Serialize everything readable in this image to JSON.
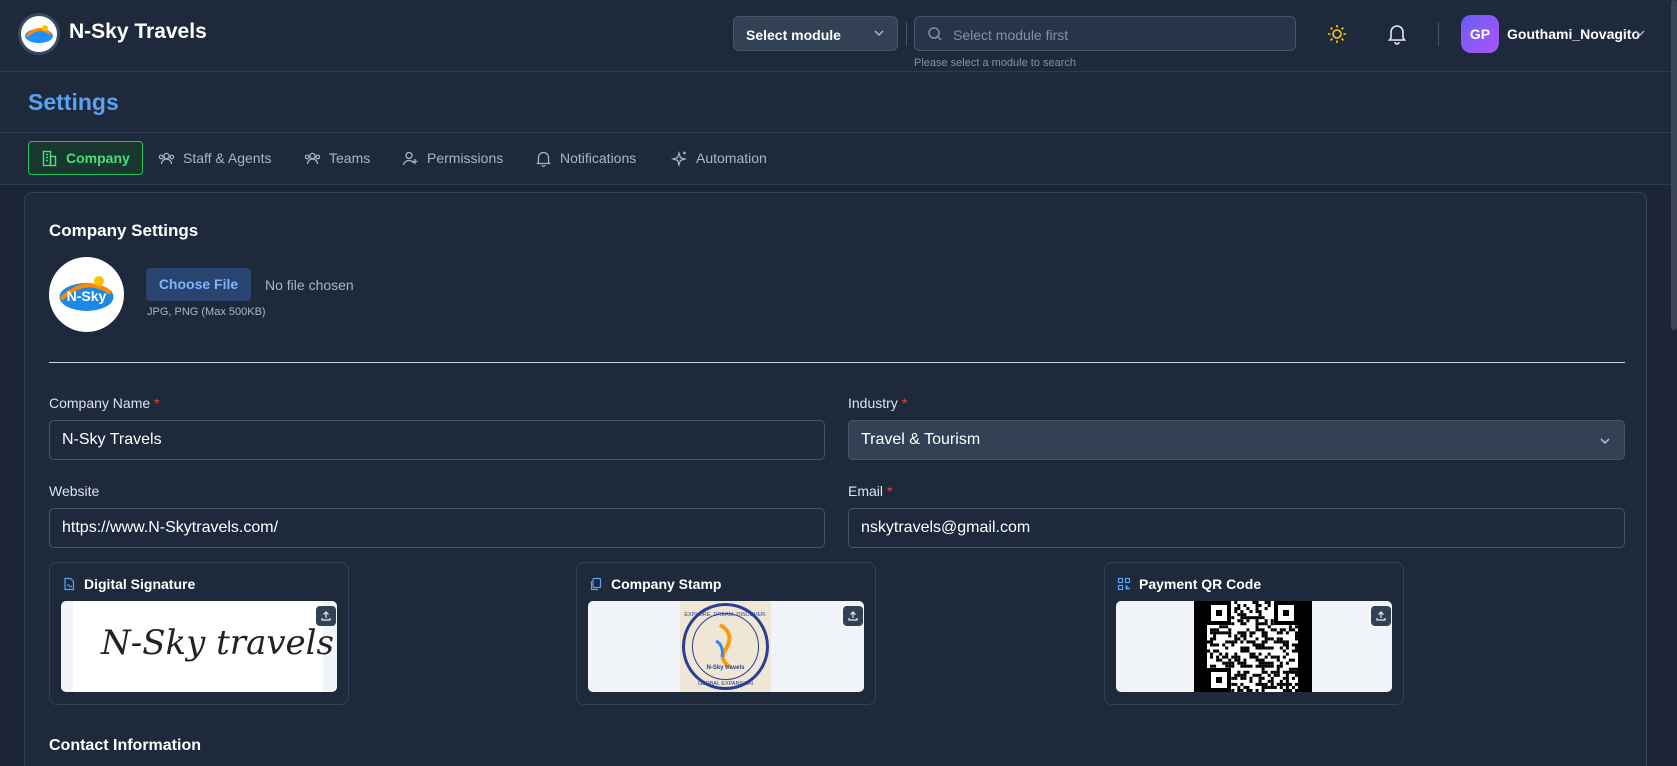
{
  "header": {
    "brand": "N-Sky Travels",
    "module_select": "Select module",
    "search_placeholder": "Select module first",
    "search_hint": "Please select a module to search",
    "user_initials": "GP",
    "user_name": "Gouthami_Novagito"
  },
  "page": {
    "title": "Settings"
  },
  "tabs": [
    {
      "label": "Company",
      "icon": "building-icon",
      "active": true
    },
    {
      "label": "Staff & Agents",
      "icon": "users-icon"
    },
    {
      "label": "Teams",
      "icon": "team-icon"
    },
    {
      "label": "Permissions",
      "icon": "user-plus-icon"
    },
    {
      "label": "Notifications",
      "icon": "bell-icon"
    },
    {
      "label": "Automation",
      "icon": "sparkles-icon"
    }
  ],
  "company": {
    "section_title": "Company Settings",
    "logo_text": "N-Sky",
    "choose_file": "Choose File",
    "no_file": "No file chosen",
    "file_hint": "JPG, PNG (Max 500KB)",
    "fields": {
      "company_name_label": "Company Name",
      "company_name_value": "N-Sky Travels",
      "industry_label": "Industry",
      "industry_value": "Travel & Tourism",
      "website_label": "Website",
      "website_value": "https://www.N-Skytravels.com/",
      "email_label": "Email",
      "email_value": "nskytravels@gmail.com",
      "required_mark": "*"
    },
    "uploads": {
      "signature_title": "Digital Signature",
      "signature_text": "N-Sky travels",
      "stamp_title": "Company Stamp",
      "stamp_top_text": "EXPLORE. DREAM. DISCOVER.",
      "stamp_brand": "N-Sky travels",
      "stamp_bottom_text": "GLOBAL EXPANSION",
      "qr_title": "Payment QR Code"
    },
    "contact_title": "Contact Information"
  },
  "colors": {
    "accent_blue": "#5aa2f3",
    "active_green": "#4ade80",
    "required_red": "#ef4444"
  }
}
